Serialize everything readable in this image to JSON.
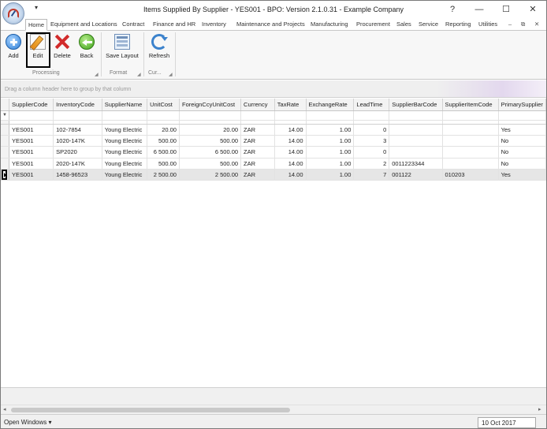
{
  "window": {
    "title": "Items Supplied By Supplier - YES001 - BPO: Version 2.1.0.31 - Example Company",
    "qat_arrow": "▾",
    "controls": {
      "help": "?",
      "minimize": "—",
      "maximize": "☐",
      "close": "✕"
    }
  },
  "ribbon_tabs": [
    {
      "label": "Home",
      "active": true
    },
    {
      "label": "Equipment and Locations"
    },
    {
      "label": "Contract"
    },
    {
      "label": "Finance and HR"
    },
    {
      "label": "Inventory"
    },
    {
      "label": "Maintenance and Projects"
    },
    {
      "label": "Manufacturing"
    },
    {
      "label": "Procurement"
    },
    {
      "label": "Sales"
    },
    {
      "label": "Service"
    },
    {
      "label": "Reporting"
    },
    {
      "label": "Utilities"
    }
  ],
  "ribbon_controls": {
    "minimize": "–",
    "restore": "⧉",
    "close": "✕"
  },
  "ribbon": {
    "processing": {
      "label": "Processing",
      "add": "Add",
      "edit": "Edit",
      "delete": "Delete",
      "back": "Back"
    },
    "format": {
      "label": "Format",
      "save_layout": "Save Layout"
    },
    "current": {
      "label": "Cur...",
      "refresh": "Refresh"
    },
    "launcher_glyph": "◢"
  },
  "group_panel": {
    "hint": "Drag a column header here to group by that column"
  },
  "grid": {
    "filter_glyph": "▼",
    "columns": [
      "SupplierCode",
      "InventoryCode",
      "SupplierName",
      "UnitCost",
      "ForeignCcyUnitCost",
      "Currency",
      "TaxRate",
      "ExchangeRate",
      "LeadTime",
      "SupplierBarCode",
      "SupplierItemCode",
      "PrimarySupplier"
    ],
    "rows": [
      [
        "YES001",
        "102-7854",
        "Young Electric",
        "20.00",
        "20.00",
        "ZAR",
        "14.00",
        "1.00",
        "0",
        "",
        "",
        "Yes"
      ],
      [
        "YES001",
        "1020-147K",
        "Young Electric",
        "500.00",
        "500.00",
        "ZAR",
        "14.00",
        "1.00",
        "3",
        "",
        "",
        "No"
      ],
      [
        "YES001",
        "SP2020",
        "Young Electric",
        "6 500.00",
        "6 500.00",
        "ZAR",
        "14.00",
        "1.00",
        "0",
        "",
        "",
        "No"
      ],
      [
        "YES001",
        "2020-147K",
        "Young Electric",
        "500.00",
        "500.00",
        "ZAR",
        "14.00",
        "1.00",
        "2",
        "0011223344",
        "",
        "No"
      ],
      [
        "YES001",
        "1458-96523",
        "Young Electric",
        "2 500.00",
        "2 500.00",
        "ZAR",
        "14.00",
        "1.00",
        "7",
        "001122",
        "010203",
        "Yes"
      ]
    ],
    "selected_row": 4
  },
  "scrollbar": {
    "left_arrow": "◂",
    "right_arrow": "▸"
  },
  "statusbar": {
    "open_windows": "Open Windows ▾",
    "date": "10 Oct 2017"
  }
}
